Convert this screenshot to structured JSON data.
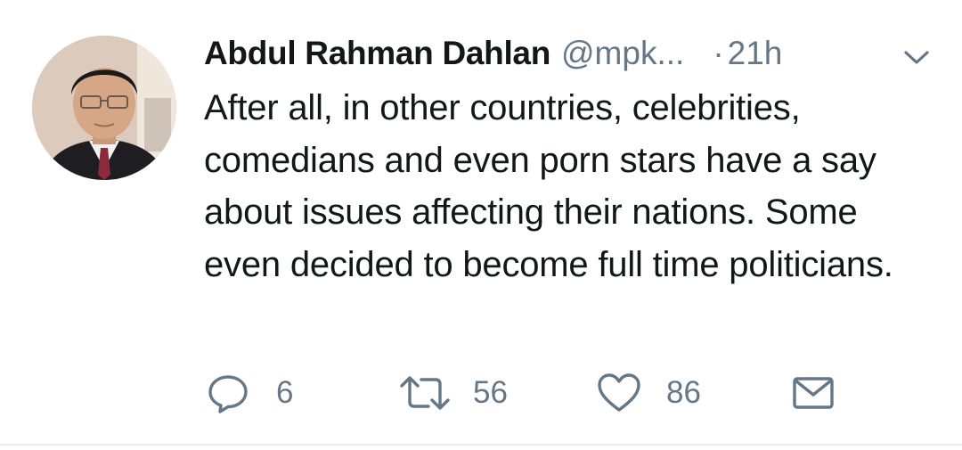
{
  "tweet": {
    "author_name": "Abdul Rahman Dahlan",
    "author_handle": "@mpk...",
    "separator": "·",
    "timestamp": "21h",
    "text": "After all, in other countries, celebrities, comedians and even porn stars have a say about issues affecting their nations. Some even decided to become full time politicians.",
    "actions": {
      "reply_count": "6",
      "retweet_count": "56",
      "like_count": "86"
    }
  },
  "icons": {
    "caret": "chevron-down-icon",
    "reply": "reply-icon",
    "retweet": "retweet-icon",
    "like": "heart-icon",
    "dm": "envelope-icon"
  },
  "colors": {
    "text": "#14171a",
    "secondary": "#657786",
    "divider": "#e6ecf0"
  }
}
